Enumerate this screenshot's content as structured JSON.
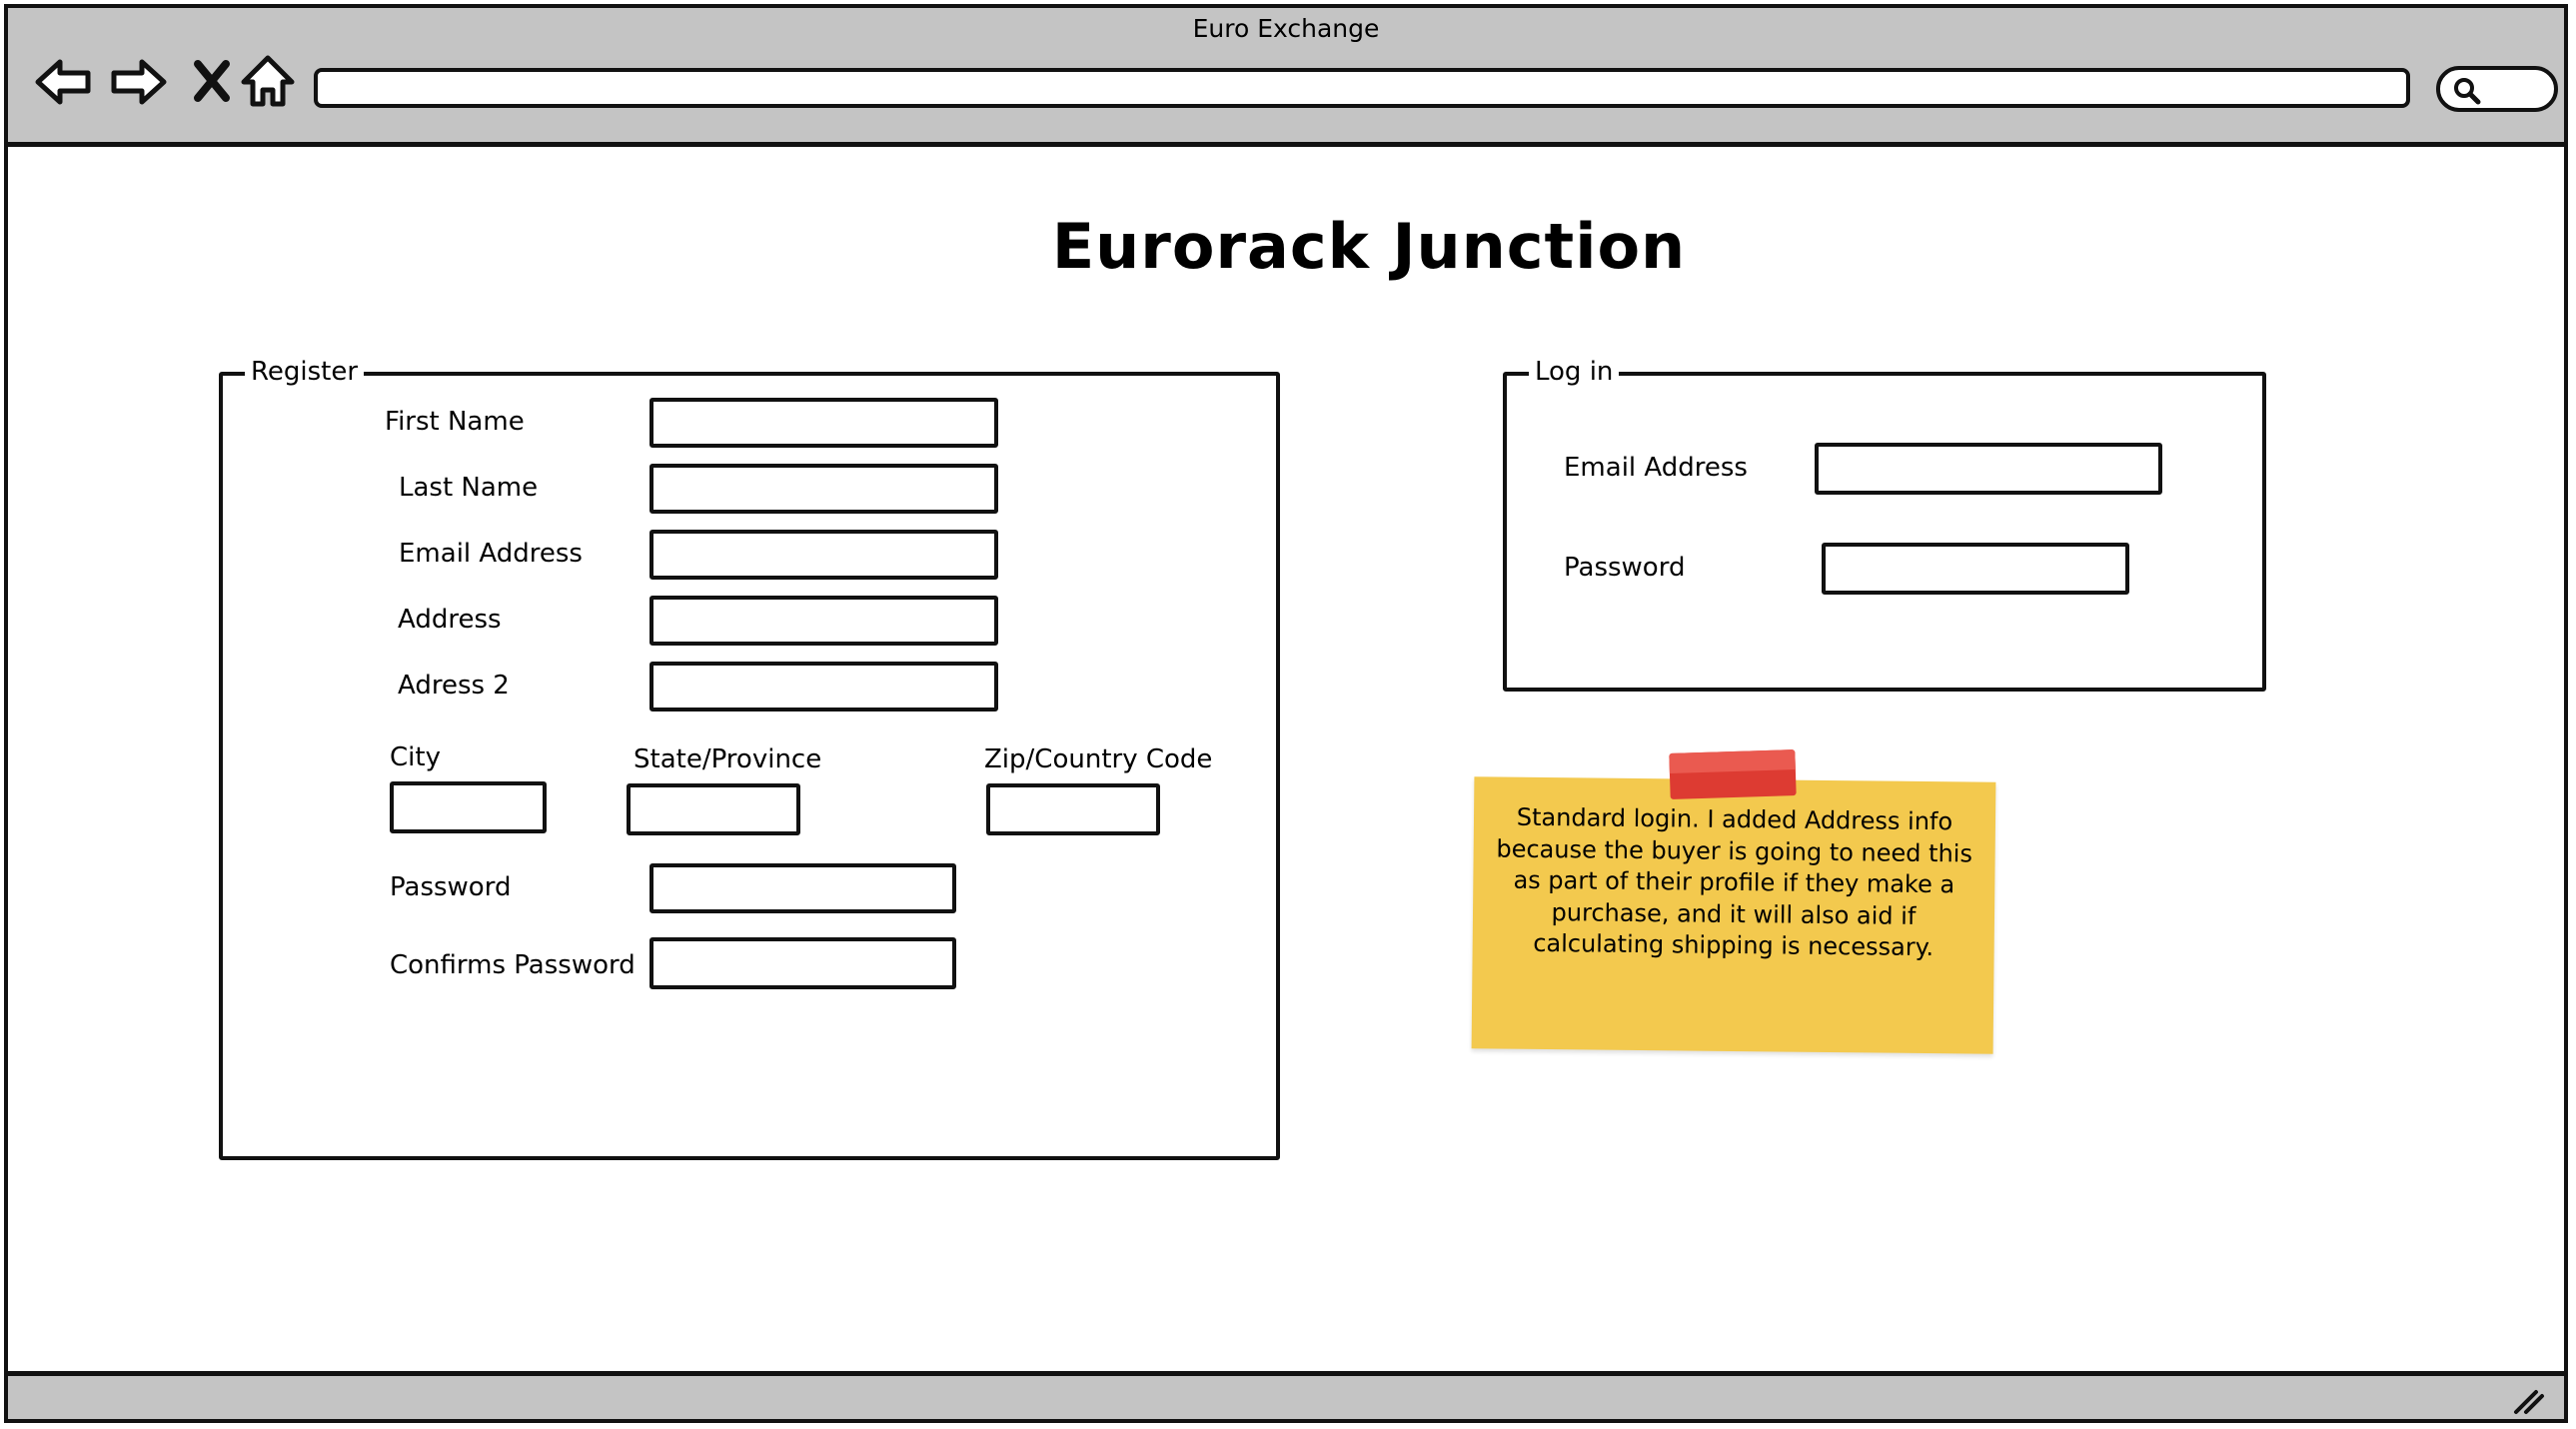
{
  "window": {
    "title": "Euro Exchange",
    "url": ""
  },
  "nav_icons": [
    "back-arrow-icon",
    "forward-arrow-icon",
    "close-x-icon",
    "home-icon",
    "search-icon",
    "resize-grip-icon"
  ],
  "page": {
    "title": "Eurorack Junction"
  },
  "register": {
    "legend": "Register",
    "first_name_label": "First Name",
    "last_name_label": "Last Name",
    "email_label": "Email Address",
    "address_label": "Address",
    "address2_label": "Adress 2",
    "city_label": "City",
    "state_label": "State/Province",
    "zip_label": "Zip/Country Code",
    "password_label": "Password",
    "confirm_password_label": "Confirms Password"
  },
  "login": {
    "legend": "Log in",
    "email_label": "Email Address",
    "password_label": "Password"
  },
  "note": {
    "text": "Standard login.  I added Address info because the buyer is going to need this as part of their profile if they make a purchase, and it will also aid if calculating shipping is necessary.",
    "color": "#f3c94e",
    "tape_color": "#dd3b32"
  }
}
